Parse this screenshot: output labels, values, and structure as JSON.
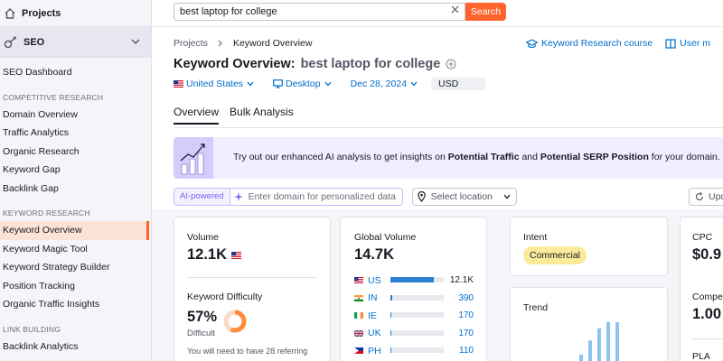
{
  "sidebar": {
    "projects": "Projects",
    "seo": "SEO",
    "items": [
      {
        "type": "item",
        "label": "SEO Dashboard"
      },
      {
        "type": "section",
        "label": "COMPETITIVE RESEARCH"
      },
      {
        "type": "item",
        "label": "Domain Overview"
      },
      {
        "type": "item",
        "label": "Traffic Analytics"
      },
      {
        "type": "item",
        "label": "Organic Research"
      },
      {
        "type": "item",
        "label": "Keyword Gap"
      },
      {
        "type": "item",
        "label": "Backlink Gap"
      },
      {
        "type": "section",
        "label": "KEYWORD RESEARCH"
      },
      {
        "type": "item",
        "label": "Keyword Overview",
        "active": true
      },
      {
        "type": "item",
        "label": "Keyword Magic Tool"
      },
      {
        "type": "item",
        "label": "Keyword Strategy Builder"
      },
      {
        "type": "item",
        "label": "Position Tracking"
      },
      {
        "type": "item",
        "label": "Organic Traffic Insights"
      },
      {
        "type": "section",
        "label": "LINK BUILDING"
      },
      {
        "type": "item",
        "label": "Backlink Analytics"
      }
    ]
  },
  "search": {
    "value": "best laptop for college",
    "button": "Search"
  },
  "breadcrumb": {
    "root": "Projects",
    "current": "Keyword Overview"
  },
  "head_links": {
    "course": "Keyword Research course",
    "manual": "User m"
  },
  "title": {
    "label": "Keyword Overview:",
    "keyword": "best laptop for college"
  },
  "filters": {
    "country": "United States",
    "device": "Desktop",
    "date": "Dec 28, 2024",
    "currency": "USD"
  },
  "tabs": [
    {
      "label": "Overview",
      "active": true
    },
    {
      "label": "Bulk Analysis"
    }
  ],
  "banner": {
    "pre": "Try out our enhanced AI analysis to get insights on ",
    "b1": "Potential Traffic",
    "mid": " and ",
    "b2": "Potential SERP Position",
    "post": " for your domain."
  },
  "ai": {
    "tag": "AI-powered",
    "placeholder": "Enter domain for personalized data",
    "location": "Select location",
    "update": "Upd"
  },
  "volume": {
    "label": "Volume",
    "value": "12.1K"
  },
  "kd": {
    "label": "Keyword Difficulty",
    "value": "57%",
    "level": "Difficult",
    "percent": 57,
    "note": "You will need to have 28 referring"
  },
  "global_volume": {
    "label": "Global Volume",
    "value": "14.7K",
    "rows": [
      {
        "code": "US",
        "value": "12.1K",
        "share": 0.82,
        "dark": true
      },
      {
        "code": "IN",
        "value": "390",
        "share": 0.03
      },
      {
        "code": "IE",
        "value": "170",
        "share": 0.012
      },
      {
        "code": "UK",
        "value": "170",
        "share": 0.012
      },
      {
        "code": "PH",
        "value": "110",
        "share": 0.008
      }
    ]
  },
  "intent": {
    "label": "Intent",
    "value": "Commercial"
  },
  "trend": {
    "label": "Trend",
    "values": [
      0.2,
      0.55,
      0.85,
      1.0,
      1.0
    ]
  },
  "cpc": {
    "label": "CPC",
    "value": "$0.9"
  },
  "competition": {
    "label": "Compet",
    "value": "1.00"
  },
  "pla": {
    "label": "PLA"
  },
  "colors": {
    "accent": "#ff642d",
    "link": "#006dca",
    "bar": "#2e7fd1",
    "intent": "#fcea9b"
  }
}
